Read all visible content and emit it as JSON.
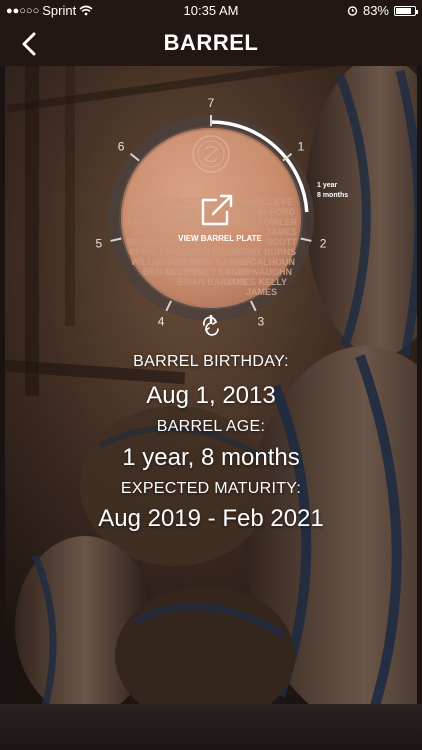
{
  "status": {
    "signal_dots": "●●○○○",
    "carrier": "Sprint",
    "time": "10:35 AM",
    "battery": "83%",
    "battery_level": 0.83
  },
  "nav": {
    "title": "BARREL"
  },
  "dial": {
    "ticks": [
      "1",
      "2",
      "3",
      "4",
      "5",
      "6",
      "7"
    ],
    "age_line1": "1 year",
    "age_line2": "8 months",
    "progress": 0.24,
    "view_label": "VIEW BARREL PLATE",
    "plate_left": [
      "KENNEDY",
      "SCOTT WRIGHT",
      "JOHN WILLIAMS",
      "JOE PUGH",
      "BRIAN TOLLIAN",
      "CHRIS ERNEST",
      "WILLIAM PALMER",
      "BEN NELSON"
    ],
    "plate_center": [
      "SCOTT MCMILLAN",
      "BEN",
      "SCOTT RUSSELL",
      "JUSTIN",
      "KEVIN PRICE",
      "ANTHONY KASSER",
      "COURTNEY KENNEY",
      "BRIAN BARTON"
    ],
    "plate_right": [
      "RAY RADCLIFFE",
      "BARB RADFORD",
      "ASHLEY FOWLER",
      "JAMES",
      "SCOTT",
      "PERRY BURNS",
      "TOM CALHOUN",
      "TODD VAUGHN",
      "JAMES KELLY",
      "JAMES"
    ]
  },
  "info": {
    "birthday_label": "BARREL BIRTHDAY:",
    "birthday": "Aug 1, 2013",
    "age_label": "BARREL AGE:",
    "age": "1 year, 8 months",
    "maturity_label": "EXPECTED MATURITY:",
    "maturity": "Aug 2019 - Feb 2021"
  },
  "colors": {
    "plate": "#c98c6d",
    "ring": "#4a403d",
    "progress": "#ffffff",
    "background": "#3b2a20"
  },
  "icons": [
    "back-chevron-icon",
    "wifi-icon",
    "alarm-icon",
    "share-arrow-icon",
    "refresh-icon"
  ]
}
